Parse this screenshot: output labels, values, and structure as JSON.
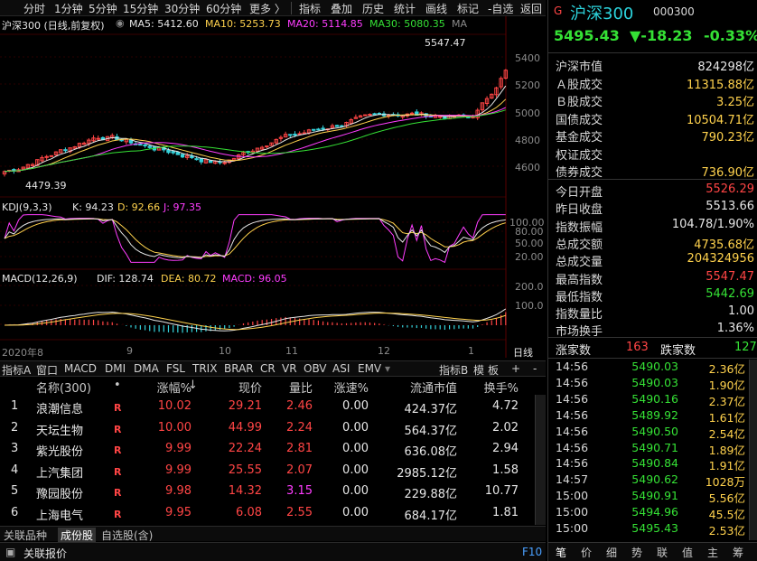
{
  "toolbar": {
    "periods": [
      "分时",
      "1分钟",
      "5分钟",
      "15分钟",
      "30分钟",
      "60分钟"
    ],
    "more": "更多 〉",
    "tools": [
      "指标",
      "叠加",
      "历史",
      "统计",
      "画线",
      "标记",
      "-自选",
      "返回"
    ]
  },
  "chart": {
    "title": "沪深300 (日线,前复权)",
    "ma5": "MA5: 5412.60",
    "ma10": "MA10: 5253.73",
    "ma20": "MA20: 5114.85",
    "ma30": "MA30: 5080.35",
    "ma_more": "MA",
    "high_label": "5547.47",
    "low_label": "4479.39",
    "price_ticks": [
      "5400",
      "5200",
      "5000",
      "4800",
      "4600"
    ],
    "kdj_label": "KDJ(9,3,3)",
    "kdj_k": "K: 94.23",
    "kdj_d": "D: 92.66",
    "kdj_j": "J: 97.35",
    "kdj_ticks": [
      "100.00",
      "80.00",
      "50.00",
      "20.00"
    ],
    "macd_label": "MACD(12,26,9)",
    "macd_dif": "DIF: 128.74",
    "macd_dea": "DEA: 80.72",
    "macd_val": "MACD: 96.05",
    "macd_ticks": [
      "200.0",
      "100.0"
    ],
    "x_labels": [
      "2020年8",
      "9",
      "10",
      "11",
      "12",
      "1"
    ],
    "x_unit": "日线"
  },
  "indicator_tabs": [
    "指标A",
    "窗口",
    "MACD",
    "DMI",
    "DMA",
    "FSL",
    "TRIX",
    "BRAR",
    "CR",
    "VR",
    "OBV",
    "ASI",
    "EMV"
  ],
  "indicator_right": [
    "指标B",
    "模",
    "板",
    "+",
    "-"
  ],
  "table": {
    "headers": [
      "名称(300)",
      "•",
      "涨幅%",
      "现价",
      "量比",
      "涨速%",
      "流通市值",
      "换手%"
    ],
    "sort_arrow": "↓",
    "rows": [
      {
        "idx": "1",
        "name": "浪潮信息",
        "flag": "R",
        "chg": "10.02",
        "price": "29.21",
        "vr": "2.46",
        "speed": "0.00",
        "cap": "424.37亿",
        "turn": "4.72"
      },
      {
        "idx": "2",
        "name": "天坛生物",
        "flag": "R",
        "chg": "10.00",
        "price": "44.99",
        "vr": "2.24",
        "speed": "0.00",
        "cap": "564.37亿",
        "turn": "2.02"
      },
      {
        "idx": "3",
        "name": "紫光股份",
        "flag": "R",
        "chg": "9.99",
        "price": "22.24",
        "vr": "2.81",
        "speed": "0.00",
        "cap": "636.08亿",
        "turn": "2.94"
      },
      {
        "idx": "4",
        "name": "上汽集团",
        "flag": "R",
        "chg": "9.99",
        "price": "25.55",
        "vr": "2.07",
        "speed": "0.00",
        "cap": "2985.12亿",
        "turn": "1.58"
      },
      {
        "idx": "5",
        "name": "豫园股份",
        "flag": "R",
        "chg": "9.98",
        "price": "14.32",
        "vr": "3.15",
        "speed": "0.00",
        "cap": "229.88亿",
        "turn": "10.77"
      },
      {
        "idx": "6",
        "name": "上海电气",
        "flag": "R",
        "chg": "9.95",
        "price": "6.08",
        "vr": "2.55",
        "speed": "0.00",
        "cap": "684.17亿",
        "turn": "1.81"
      }
    ]
  },
  "bottom_tabs": [
    "关联品种",
    "成份股",
    "自选股(含)"
  ],
  "status": {
    "left": "关联报价",
    "right": "F10"
  },
  "quote": {
    "badge": "G",
    "name": "沪深300",
    "code": "000300",
    "price": "5495.43",
    "change": "▼-18.23",
    "pct": "-0.33%"
  },
  "stats_a": [
    {
      "k": "沪深市值",
      "v": "824298亿",
      "c": "white"
    },
    {
      "k": "Ａ股成交",
      "v": "11315.88亿",
      "c": "yellow"
    },
    {
      "k": "Ｂ股成交",
      "v": "3.25亿",
      "c": "yellow"
    },
    {
      "k": "国债成交",
      "v": "10504.71亿",
      "c": "yellow"
    },
    {
      "k": "基金成交",
      "v": "790.23亿",
      "c": "yellow"
    },
    {
      "k": "权证成交",
      "v": "",
      "c": "yellow"
    },
    {
      "k": "债券成交",
      "v": "736.90亿",
      "c": "yellow"
    }
  ],
  "stats_b": [
    {
      "k": "今日开盘",
      "v": "5526.29",
      "c": "red"
    },
    {
      "k": "昨日收盘",
      "v": "5513.66",
      "c": "white"
    },
    {
      "k": "指数振幅",
      "v": "104.78/1.90%",
      "c": "white"
    },
    {
      "k": "总成交额",
      "v": "4735.68亿",
      "c": "yellow"
    },
    {
      "k": "总成交量",
      "v": "204324956",
      "c": "yellow"
    },
    {
      "k": "最高指数",
      "v": "5547.47",
      "c": "red"
    },
    {
      "k": "最低指数",
      "v": "5442.69",
      "c": "green"
    },
    {
      "k": "指数量比",
      "v": "1.00",
      "c": "white"
    },
    {
      "k": "市场换手",
      "v": "1.36%",
      "c": "white"
    }
  ],
  "updown": {
    "up_label": "涨家数",
    "up": "163",
    "down_label": "跌家数",
    "down": "127"
  },
  "ticks": [
    {
      "t": "14:56",
      "p": "5490.03",
      "q": "2.36亿"
    },
    {
      "t": "14:56",
      "p": "5490.03",
      "q": "1.90亿"
    },
    {
      "t": "14:56",
      "p": "5490.16",
      "q": "2.37亿"
    },
    {
      "t": "14:56",
      "p": "5489.92",
      "q": "1.61亿"
    },
    {
      "t": "14:56",
      "p": "5490.50",
      "q": "2.54亿"
    },
    {
      "t": "14:56",
      "p": "5490.71",
      "q": "1.89亿"
    },
    {
      "t": "14:56",
      "p": "5490.84",
      "q": "1.91亿"
    },
    {
      "t": "14:57",
      "p": "5490.62",
      "q": "1028万"
    },
    {
      "t": "15:00",
      "p": "5490.91",
      "q": "5.56亿"
    },
    {
      "t": "15:00",
      "p": "5494.96",
      "q": "45.5亿"
    },
    {
      "t": "15:00",
      "p": "5495.43",
      "q": "2.53亿"
    }
  ],
  "right_tabs": [
    "笔",
    "价",
    "细",
    "势",
    "联",
    "值",
    "主",
    "筹"
  ],
  "colors": {
    "up": "#ff4545",
    "down": "#35e135",
    "ma5": "#e6e6e6",
    "ma10": "#ffd24d",
    "ma20": "#ff3dff",
    "ma30": "#35e135"
  }
}
